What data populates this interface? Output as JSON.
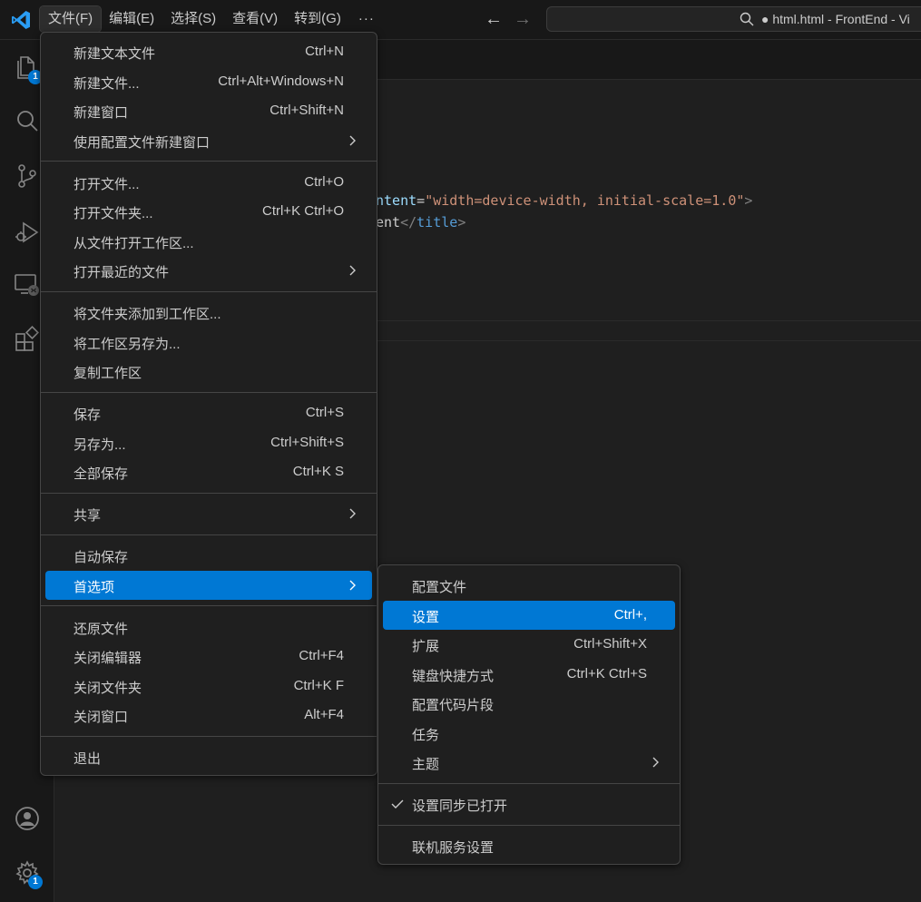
{
  "titlebar": {
    "menus": [
      {
        "label": "文件(F)",
        "active": true
      },
      {
        "label": "编辑(E)"
      },
      {
        "label": "选择(S)"
      },
      {
        "label": "查看(V)"
      },
      {
        "label": "转到(G)"
      }
    ],
    "more": "···",
    "back_arrow": "←",
    "forward_arrow": "→",
    "window_title": "● html.html - FrontEnd - Vi"
  },
  "activity_bar": {
    "explorer_badge": "1",
    "settings_badge": "1",
    "icons": [
      "files-icon",
      "search-icon",
      "source-control-icon",
      "run-debug-icon",
      "remote-explorer-icon",
      "extensions-icon",
      "account-icon",
      "settings-gear-icon"
    ]
  },
  "editor": {
    "line1": {
      "attr": "ntent",
      "eq": "=",
      "str": "\"width=device-width, initial-scale=1.0\"",
      "close": ">"
    },
    "line2": {
      "text": "ent",
      "open": "</",
      "tag": "title",
      "close": ">"
    }
  },
  "file_menu": {
    "groups": [
      [
        {
          "label": "新建文本文件",
          "shortcut": "Ctrl+N"
        },
        {
          "label": "新建文件...",
          "shortcut": "Ctrl+Alt+Windows+N"
        },
        {
          "label": "新建窗口",
          "shortcut": "Ctrl+Shift+N"
        },
        {
          "label": "使用配置文件新建窗口",
          "submenu": true
        }
      ],
      [
        {
          "label": "打开文件...",
          "shortcut": "Ctrl+O"
        },
        {
          "label": "打开文件夹...",
          "shortcut": "Ctrl+K Ctrl+O"
        },
        {
          "label": "从文件打开工作区..."
        },
        {
          "label": "打开最近的文件",
          "submenu": true
        }
      ],
      [
        {
          "label": "将文件夹添加到工作区..."
        },
        {
          "label": "将工作区另存为..."
        },
        {
          "label": "复制工作区"
        }
      ],
      [
        {
          "label": "保存",
          "shortcut": "Ctrl+S"
        },
        {
          "label": "另存为...",
          "shortcut": "Ctrl+Shift+S"
        },
        {
          "label": "全部保存",
          "shortcut": "Ctrl+K S"
        }
      ],
      [
        {
          "label": "共享",
          "submenu": true
        }
      ],
      [
        {
          "label": "自动保存"
        },
        {
          "label": "首选项",
          "submenu": true,
          "highlighted": true
        }
      ],
      [
        {
          "label": "还原文件"
        },
        {
          "label": "关闭编辑器",
          "shortcut": "Ctrl+F4"
        },
        {
          "label": "关闭文件夹",
          "shortcut": "Ctrl+K F"
        },
        {
          "label": "关闭窗口",
          "shortcut": "Alt+F4"
        }
      ],
      [
        {
          "label": "退出"
        }
      ]
    ]
  },
  "preferences_menu": {
    "groups": [
      [
        {
          "label": "配置文件"
        },
        {
          "label": "设置",
          "shortcut": "Ctrl+,",
          "highlighted": true
        },
        {
          "label": "扩展",
          "shortcut": "Ctrl+Shift+X"
        },
        {
          "label": "键盘快捷方式",
          "shortcut": "Ctrl+K Ctrl+S"
        },
        {
          "label": "配置代码片段"
        },
        {
          "label": "任务"
        },
        {
          "label": "主题",
          "submenu": true
        }
      ],
      [
        {
          "label": "设置同步已打开",
          "checked": true
        }
      ],
      [
        {
          "label": "联机服务设置"
        }
      ]
    ]
  },
  "colors": {
    "accent": "#0078d4",
    "background": "#1f1f1f",
    "menu_border": "#454545"
  }
}
